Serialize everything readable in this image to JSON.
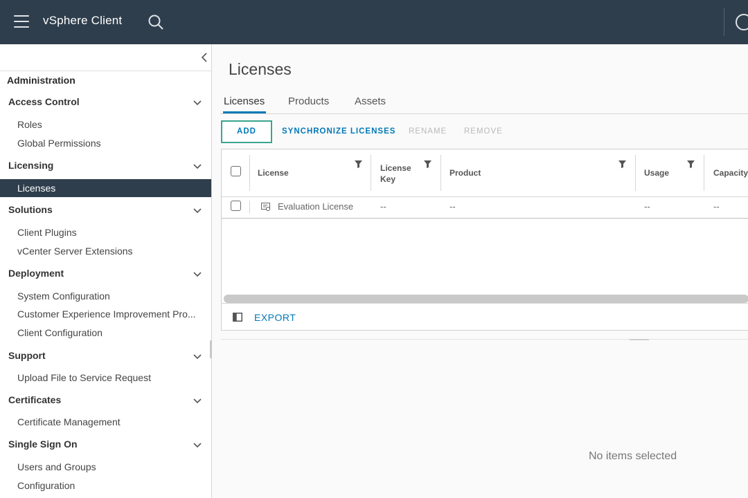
{
  "header": {
    "app_title": "vSphere Client"
  },
  "sidebar": {
    "root": "Administration",
    "sections": [
      {
        "title": "Access Control",
        "items": [
          "Roles",
          "Global Permissions"
        ]
      },
      {
        "title": "Licensing",
        "items": [
          "Licenses"
        ],
        "active_item": "Licenses"
      },
      {
        "title": "Solutions",
        "items": [
          "Client Plugins",
          "vCenter Server Extensions"
        ]
      },
      {
        "title": "Deployment",
        "items": [
          "System Configuration",
          "Customer Experience Improvement Pro...",
          "Client Configuration"
        ]
      },
      {
        "title": "Support",
        "items": [
          "Upload File to Service Request"
        ]
      },
      {
        "title": "Certificates",
        "items": [
          "Certificate Management"
        ]
      },
      {
        "title": "Single Sign On",
        "items": [
          "Users and Groups",
          "Configuration"
        ]
      }
    ]
  },
  "main": {
    "title": "Licenses",
    "tabs": [
      "Licenses",
      "Products",
      "Assets"
    ],
    "active_tab": "Licenses",
    "toolbar": {
      "add": "ADD",
      "synchronize": "SYNCHRONIZE LICENSES",
      "rename": "RENAME",
      "remove": "REMOVE"
    },
    "grid": {
      "columns": [
        "License",
        "License\nKey",
        "Product",
        "Usage",
        "Capacity"
      ],
      "rows": [
        {
          "license": "Evaluation License",
          "license_key": "--",
          "product": "--",
          "usage": "--",
          "capacity": "--"
        }
      ],
      "export_label": "EXPORT"
    },
    "detail_empty": "No items selected"
  },
  "colors": {
    "header_bg": "#2f3e4c",
    "accent": "#0079b8",
    "highlight_border": "#3ba58e"
  }
}
